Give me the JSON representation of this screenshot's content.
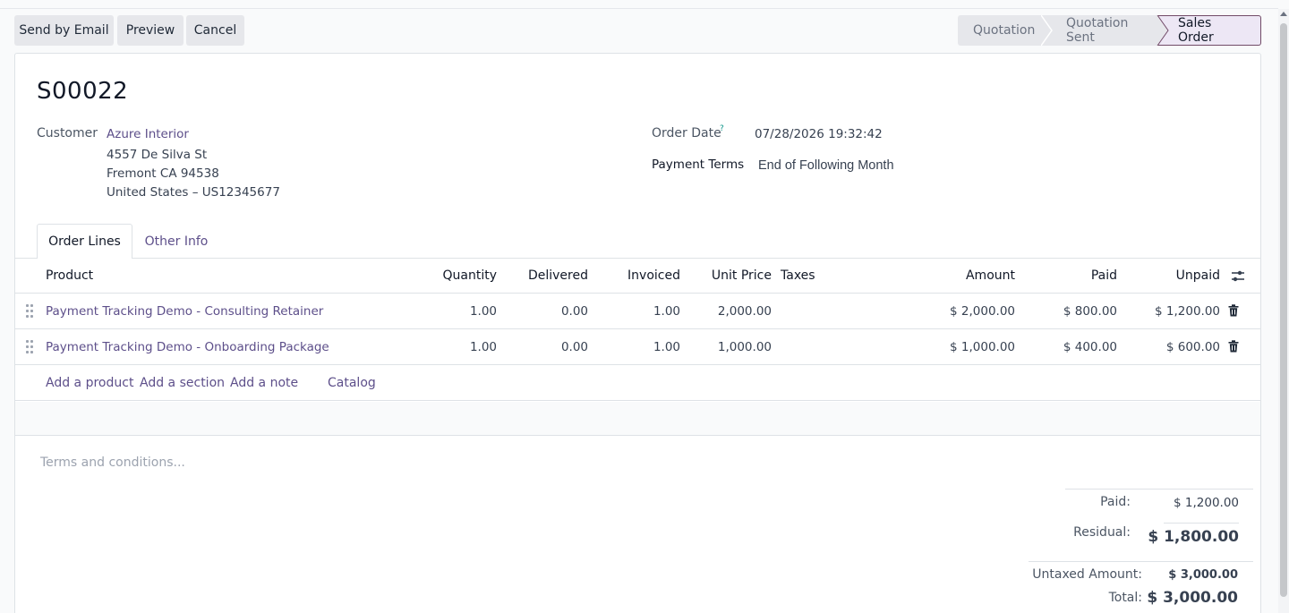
{
  "toolbar": {
    "send_email": "Send by Email",
    "preview": "Preview",
    "cancel": "Cancel"
  },
  "status": {
    "steps": [
      "Quotation",
      "Quotation Sent",
      "Sales Order"
    ],
    "active": "Sales Order"
  },
  "order": {
    "name": "S00022",
    "customer_label": "Customer",
    "customer_name": "Azure Interior",
    "address_line1": "4557 De Silva St",
    "address_line2": "Fremont CA 94538",
    "address_line3": "United States – US12345677",
    "order_date_label": "Order Date",
    "order_date_help": "?",
    "order_date": "07/28/2026 19:32:42",
    "payment_terms_label": "Payment Terms",
    "payment_terms": "End of Following Month"
  },
  "tabs": [
    {
      "label": "Order Lines"
    },
    {
      "label": "Other Info"
    }
  ],
  "table": {
    "headers": {
      "product": "Product",
      "quantity": "Quantity",
      "delivered": "Delivered",
      "invoiced": "Invoiced",
      "unit_price": "Unit Price",
      "taxes": "Taxes",
      "amount": "Amount",
      "paid": "Paid",
      "unpaid": "Unpaid"
    },
    "rows": [
      {
        "product": "Payment Tracking Demo - Consulting Retainer",
        "quantity": "1.00",
        "delivered": "0.00",
        "invoiced": "1.00",
        "unit_price": "2,000.00",
        "taxes": "",
        "amount": "$ 2,000.00",
        "paid": "$ 800.00",
        "unpaid": "$ 1,200.00"
      },
      {
        "product": "Payment Tracking Demo - Onboarding Package",
        "quantity": "1.00",
        "delivered": "0.00",
        "invoiced": "1.00",
        "unit_price": "1,000.00",
        "taxes": "",
        "amount": "$ 1,000.00",
        "paid": "$ 400.00",
        "unpaid": "$ 600.00"
      }
    ],
    "actions": {
      "add_product": "Add a product",
      "add_section": "Add a section",
      "add_note": "Add a note",
      "catalog": "Catalog"
    }
  },
  "terms_placeholder": "Terms and conditions...",
  "totals": {
    "paid_label": "Paid:",
    "paid_value": "$ 1,200.00",
    "residual_label": "Residual:",
    "residual_value": "$ 1,800.00",
    "untaxed_label": "Untaxed Amount:",
    "untaxed_value": "$ 3,000.00",
    "total_label": "Total:",
    "total_value": "$ 3,000.00"
  },
  "colors": {
    "accent": "#714b67",
    "link": "#5d4f8a",
    "button_bg": "#e6e7eb"
  }
}
